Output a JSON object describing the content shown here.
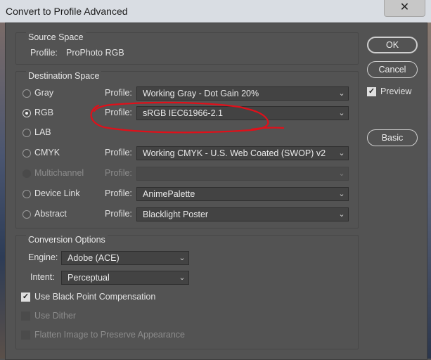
{
  "window": {
    "title": "Convert to Profile Advanced",
    "close_glyph": "✕"
  },
  "source_space": {
    "legend": "Source Space",
    "profile_label": "Profile:",
    "profile_value": "ProPhoto RGB"
  },
  "destination_space": {
    "legend": "Destination Space",
    "rows": [
      {
        "mode": "Gray",
        "profile_label": "Profile:",
        "value": "Working Gray - Dot Gain 20%",
        "selected": false,
        "enabled": true
      },
      {
        "mode": "RGB",
        "profile_label": "Profile:",
        "value": "sRGB IEC61966-2.1",
        "selected": true,
        "enabled": true
      },
      {
        "mode": "LAB",
        "profile_label": "",
        "value": "",
        "selected": false,
        "enabled": true
      },
      {
        "mode": "CMYK",
        "profile_label": "Profile:",
        "value": "Working CMYK - U.S. Web Coated (SWOP) v2",
        "selected": false,
        "enabled": true
      },
      {
        "mode": "Multichannel",
        "profile_label": "Profile:",
        "value": "",
        "selected": false,
        "enabled": false
      },
      {
        "mode": "Device Link",
        "profile_label": "Profile:",
        "value": "AnimePalette",
        "selected": false,
        "enabled": true
      },
      {
        "mode": "Abstract",
        "profile_label": "Profile:",
        "value": "Blacklight Poster",
        "selected": false,
        "enabled": true
      }
    ]
  },
  "conversion_options": {
    "legend": "Conversion Options",
    "engine_label": "Engine:",
    "engine_value": "Adobe (ACE)",
    "intent_label": "Intent:",
    "intent_value": "Perceptual",
    "black_point_label": "Use Black Point Compensation",
    "black_point_checked": true,
    "dither_label": "Use Dither",
    "flatten_label": "Flatten Image to Preserve Appearance"
  },
  "buttons": {
    "ok": "OK",
    "cancel": "Cancel",
    "preview": "Preview",
    "preview_checked": true,
    "basic": "Basic"
  },
  "annotation": {
    "color": "#e0101a",
    "description_shape": "hand-drawn-ellipse"
  },
  "colors": {
    "dialog_bg": "#535353",
    "field_bg": "#434343",
    "titlebar_bg": "#d9dde3",
    "annotation_red": "#e0101a"
  }
}
